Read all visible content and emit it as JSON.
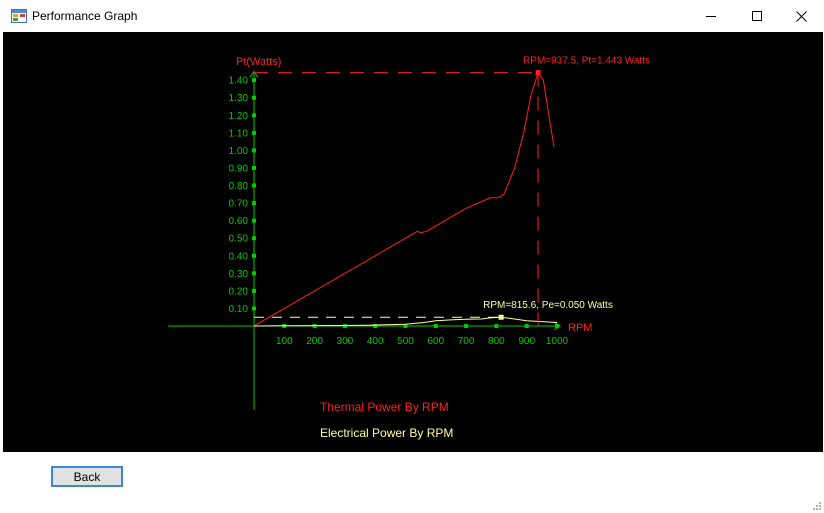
{
  "window": {
    "title": "Performance Graph",
    "icon": "form-icon"
  },
  "controls": {
    "minimize": "minimize-icon",
    "maximize": "maximize-icon",
    "close": "close-icon"
  },
  "buttons": {
    "back_label": "Back"
  },
  "colors": {
    "thermal": "#ff2020",
    "electrical": "#ffff99",
    "axis": "#00cc00",
    "background": "#000000"
  },
  "chart_data": {
    "type": "line",
    "ylabel": "Pt(Watts)",
    "xlabel": "RPM",
    "xlim": [
      0,
      1000
    ],
    "ylim": [
      0,
      1.4
    ],
    "x_ticks": [
      "100",
      "200",
      "300",
      "400",
      "500",
      "600",
      "700",
      "800",
      "900",
      "1000"
    ],
    "y_ticks": [
      "0.10",
      "0.20",
      "0.30",
      "0.40",
      "0.50",
      "0.60",
      "0.70",
      "0.80",
      "0.90",
      "1.00",
      "1.10",
      "1.20",
      "1.30",
      "1.40"
    ],
    "series": [
      {
        "name": "Thermal Power By RPM",
        "points": [
          [
            0,
            0.0
          ],
          [
            50,
            0.05
          ],
          [
            100,
            0.1
          ],
          [
            200,
            0.2
          ],
          [
            300,
            0.3
          ],
          [
            400,
            0.4
          ],
          [
            500,
            0.5
          ],
          [
            530,
            0.53
          ],
          [
            540,
            0.54
          ],
          [
            550,
            0.53
          ],
          [
            570,
            0.54
          ],
          [
            600,
            0.57
          ],
          [
            700,
            0.67
          ],
          [
            780,
            0.73
          ],
          [
            805,
            0.73
          ],
          [
            825,
            0.75
          ],
          [
            860,
            0.9
          ],
          [
            890,
            1.1
          ],
          [
            915,
            1.32
          ],
          [
            937.5,
            1.443
          ],
          [
            955,
            1.4
          ],
          [
            975,
            1.18
          ],
          [
            990,
            1.02
          ]
        ]
      },
      {
        "name": "Electrical Power By RPM",
        "points": [
          [
            0,
            0.0
          ],
          [
            100,
            0.001
          ],
          [
            200,
            0.002
          ],
          [
            300,
            0.003
          ],
          [
            400,
            0.005
          ],
          [
            500,
            0.01
          ],
          [
            560,
            0.02
          ],
          [
            600,
            0.03
          ],
          [
            650,
            0.035
          ],
          [
            700,
            0.038
          ],
          [
            750,
            0.04
          ],
          [
            780,
            0.046
          ],
          [
            815.6,
            0.05
          ],
          [
            860,
            0.04
          ],
          [
            900,
            0.03
          ],
          [
            950,
            0.025
          ],
          [
            1000,
            0.02
          ]
        ]
      }
    ],
    "annotations": [
      {
        "text": "RPM=937.5, Pt=1.443 Watts",
        "x": 937.5,
        "y": 1.443,
        "series": "Thermal Power By RPM"
      },
      {
        "text": "RPM=815.6, Pe=0.050 Watts",
        "x": 815.6,
        "y": 0.05,
        "series": "Electrical Power By RPM"
      }
    ],
    "legend": [
      "Thermal Power By RPM",
      "Electrical Power By RPM"
    ]
  }
}
